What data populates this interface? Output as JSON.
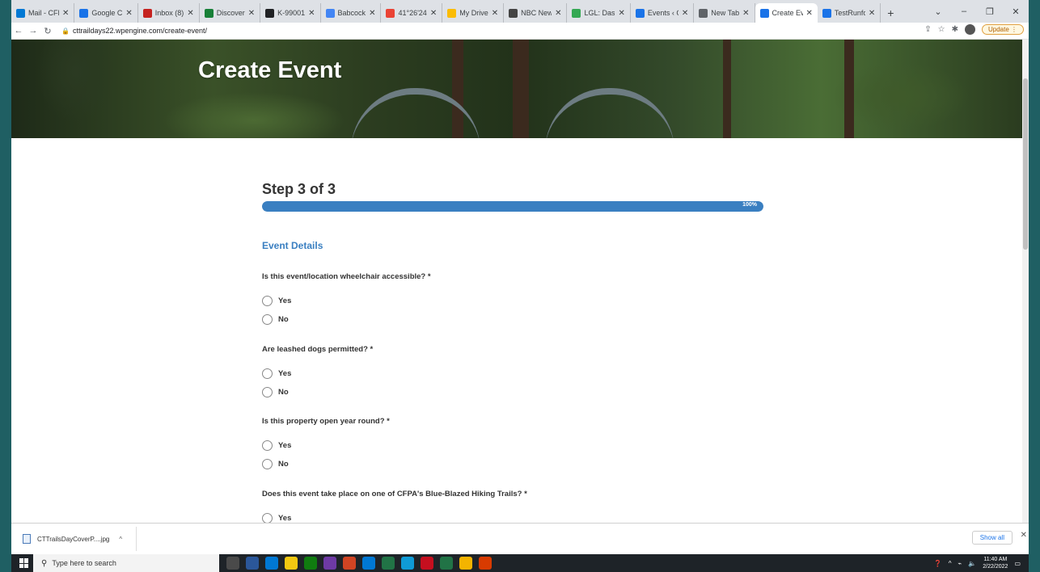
{
  "browser": {
    "tabs": [
      {
        "title": "Mail - CFP",
        "color": "#0078d4"
      },
      {
        "title": "Google Cl",
        "color": "#1a73e8"
      },
      {
        "title": "Inbox (8)",
        "color": "#c5221f"
      },
      {
        "title": "Discover",
        "color": "#188038"
      },
      {
        "title": "K-99001",
        "color": "#202124"
      },
      {
        "title": "Babcock",
        "color": "#4285f4"
      },
      {
        "title": "41°26'24",
        "color": "#ea4335"
      },
      {
        "title": "My Drive",
        "color": "#fbbc04"
      },
      {
        "title": "NBC New",
        "color": "#444444"
      },
      {
        "title": "LGL: Das",
        "color": "#34a853"
      },
      {
        "title": "Events ‹ C",
        "color": "#1a73e8"
      },
      {
        "title": "New Tab",
        "color": "#5f6368"
      },
      {
        "title": "Create Ev",
        "color": "#1a73e8",
        "active": true
      },
      {
        "title": "TestRunfo",
        "color": "#1a73e8"
      }
    ],
    "url": "cttraildays22.wpengine.com/create-event/",
    "update_label": "Update"
  },
  "hero": {
    "title": "Create Event"
  },
  "form": {
    "step": "Step 3 of 3",
    "progress_label": "100%",
    "progress_value": 100,
    "section": "Event Details",
    "questions": [
      {
        "label": "Is this event/location wheelchair accessible? *",
        "options": [
          "Yes",
          "No"
        ]
      },
      {
        "label": "Are leashed dogs permitted? *",
        "options": [
          "Yes",
          "No"
        ]
      },
      {
        "label": "Is this property open year round? *",
        "options": [
          "Yes",
          "No"
        ]
      },
      {
        "label": "Does this event take place on one of CFPA's Blue-Blazed Hiking Trails? *",
        "options": [
          "Yes"
        ]
      }
    ]
  },
  "downloads": {
    "file": "CTTrailsDayCoverP....jpg",
    "show_all": "Show all"
  },
  "taskbar": {
    "search_placeholder": "Type here to search",
    "time": "11:40 AM",
    "date": "2/22/2022",
    "app_colors": [
      "#4a4a4a",
      "#2b579a",
      "#0078d4",
      "#f2c811",
      "#107c10",
      "#6e3aa5",
      "#d04423",
      "#0078d4",
      "#217346",
      "#0f9bd7",
      "#c50f1f",
      "#217346",
      "#f4b400",
      "#d83b01"
    ]
  }
}
